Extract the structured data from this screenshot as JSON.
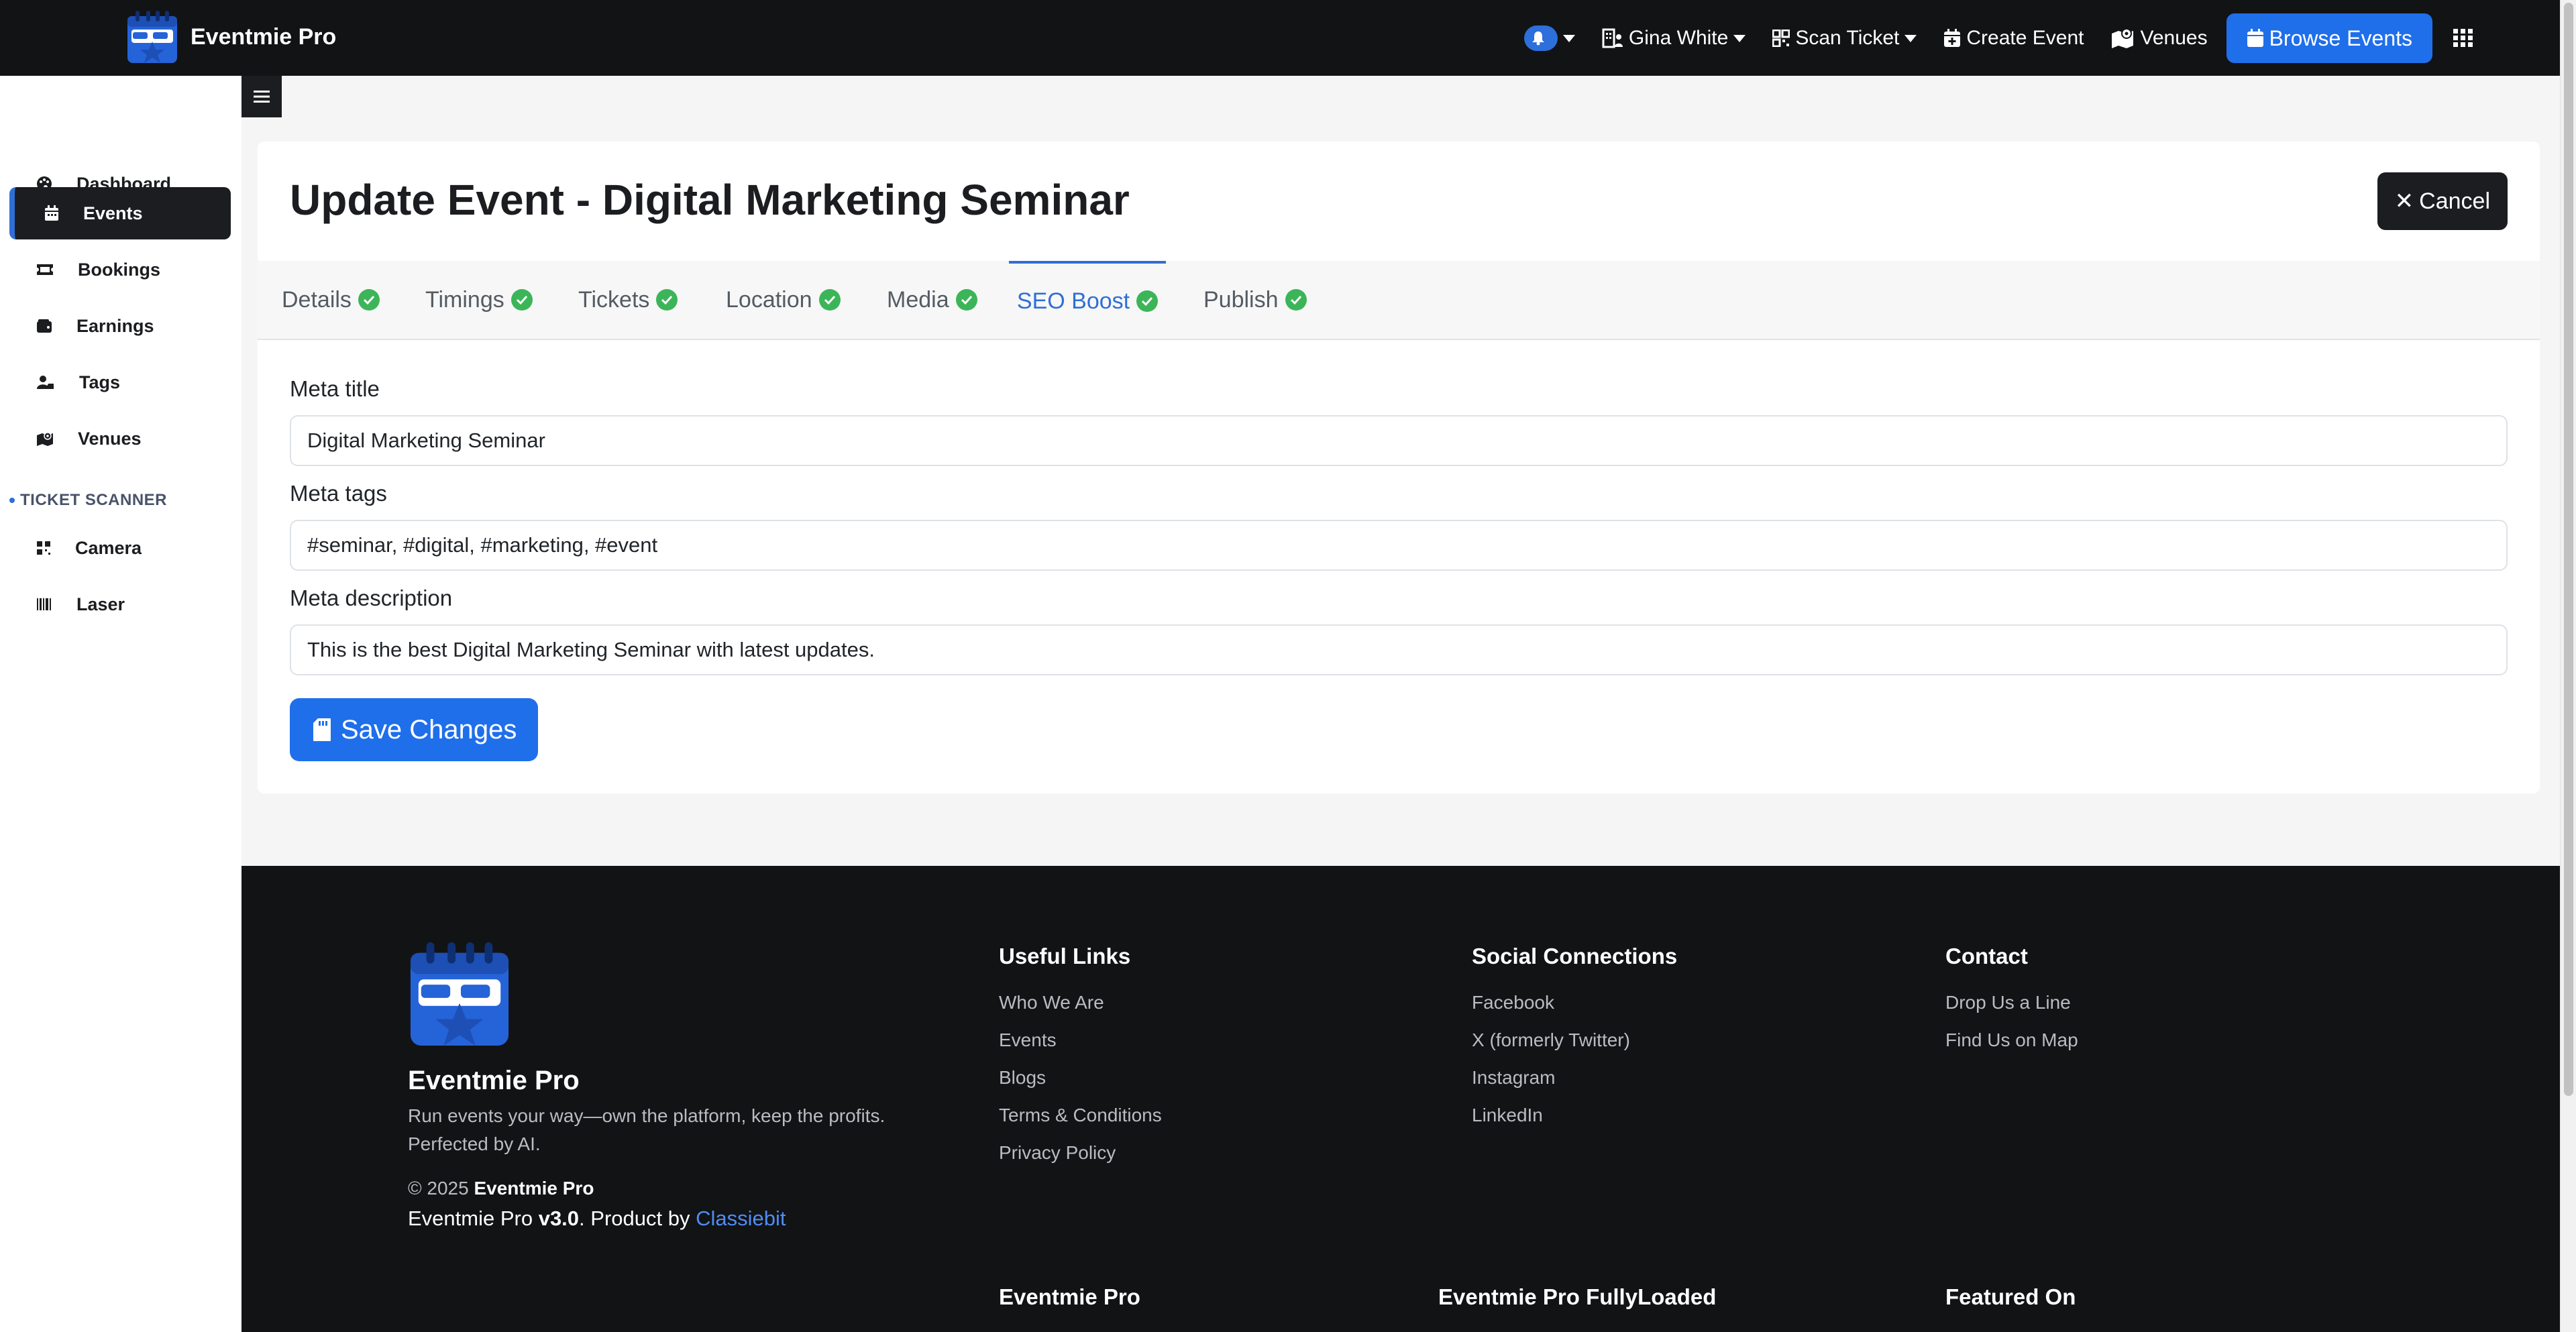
{
  "brand": {
    "name": "Eventmie Pro"
  },
  "topnav": {
    "user_name": "Gina White",
    "scan_ticket": "Scan Ticket",
    "create_event": "Create Event",
    "venues": "Venues",
    "browse_events": "Browse Events"
  },
  "sidebar": {
    "items": [
      {
        "label": "Dashboard",
        "icon": "palette-icon"
      },
      {
        "label": "Events",
        "icon": "calendar-icon",
        "active": true
      },
      {
        "label": "Bookings",
        "icon": "ticket-icon"
      },
      {
        "label": "Earnings",
        "icon": "wallet-icon"
      },
      {
        "label": "Tags",
        "icon": "user-tag-icon"
      },
      {
        "label": "Venues",
        "icon": "map-icon"
      }
    ],
    "scanner_heading": "TICKET SCANNER",
    "scanner_items": [
      {
        "label": "Camera",
        "icon": "qrcode-icon"
      },
      {
        "label": "Laser",
        "icon": "barcode-icon"
      }
    ]
  },
  "page": {
    "title": "Update Event - Digital Marketing Seminar",
    "cancel_label": "Cancel"
  },
  "tabs": [
    {
      "label": "Details",
      "complete": true
    },
    {
      "label": "Timings",
      "complete": true
    },
    {
      "label": "Tickets",
      "complete": true
    },
    {
      "label": "Location",
      "complete": true
    },
    {
      "label": "Media",
      "complete": true
    },
    {
      "label": "SEO Boost",
      "complete": true,
      "active": true
    },
    {
      "label": "Publish",
      "complete": true
    }
  ],
  "form": {
    "meta_title_label": "Meta title",
    "meta_title_value": "Digital Marketing Seminar",
    "meta_tags_label": "Meta tags",
    "meta_tags_value": "#seminar, #digital, #marketing, #event",
    "meta_description_label": "Meta description",
    "meta_description_value": "This is the best Digital Marketing Seminar with latest updates.",
    "save_label": "Save Changes"
  },
  "footer": {
    "brand": "Eventmie Pro",
    "tagline": "Run events your way—own the platform, keep the profits. Perfected by AI.",
    "copyright_prefix": "© 2025",
    "copyright_brand": "Eventmie Pro",
    "version_prefix": "Eventmie Pro",
    "version": "v3.0",
    "product_by": ". Product by",
    "company": "Classiebit",
    "useful_links": {
      "title": "Useful Links",
      "links": [
        "Who We Are",
        "Events",
        "Blogs",
        "Terms & Conditions",
        "Privacy Policy"
      ]
    },
    "social": {
      "title": "Social Connections",
      "links": [
        "Facebook",
        "X (formerly Twitter)",
        "Instagram",
        "LinkedIn"
      ]
    },
    "contact": {
      "title": "Contact",
      "links": [
        "Drop Us a Line",
        "Find Us on Map"
      ]
    },
    "bottom_titles": [
      "Eventmie Pro",
      "Eventmie Pro FullyLoaded",
      "Featured On"
    ]
  },
  "colors": {
    "navbar_bg": "#121315",
    "primary": "#1f6feb",
    "success": "#3cb559",
    "sidebar_active": "#1b1d20"
  }
}
